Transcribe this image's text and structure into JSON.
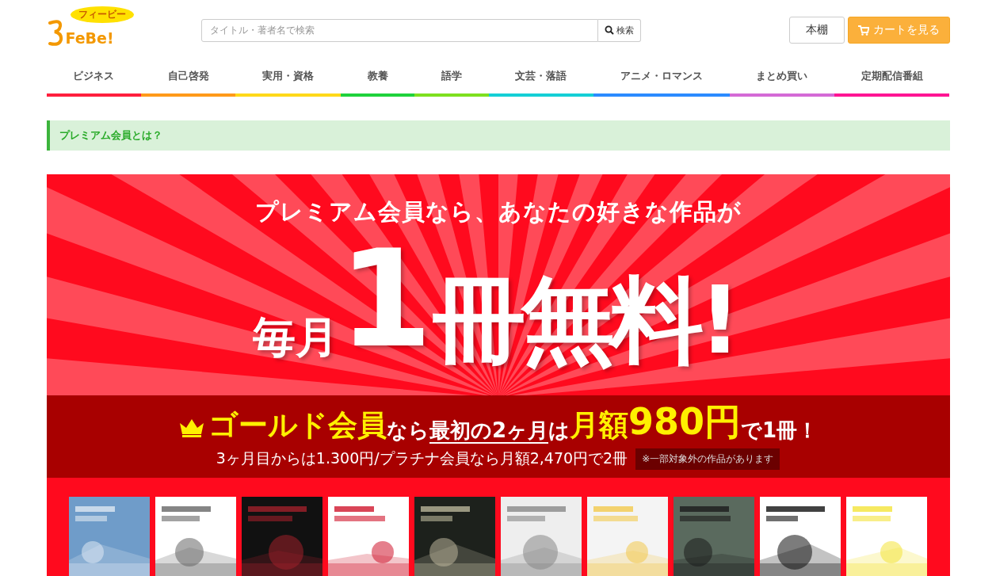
{
  "header": {
    "logo": {
      "name": "FeBe!",
      "badge": "フィービー"
    },
    "search": {
      "placeholder": "タイトル・著者名で検索",
      "button": "検索"
    },
    "buttons": [
      {
        "label": "本棚",
        "kind": "plain"
      },
      {
        "label": "カートを見る",
        "kind": "cart"
      }
    ]
  },
  "nav": [
    {
      "label": "ビジネス",
      "color": "#ff1f3d"
    },
    {
      "label": "自己啓発",
      "color": "#ff9a1a"
    },
    {
      "label": "実用・資格",
      "color": "#ffd91a"
    },
    {
      "label": "教養",
      "color": "#1fd23c"
    },
    {
      "label": "語学",
      "color": "#7ee01f"
    },
    {
      "label": "文芸・落語",
      "color": "#14cfd6"
    },
    {
      "label": "アニメ・ロマンス",
      "color": "#2b8bff"
    },
    {
      "label": "まとめ買い",
      "color": "#d46ad6"
    },
    {
      "label": "定期配信番組",
      "color": "#ff1493"
    }
  ],
  "notice": "プレミアム会員とは？",
  "banner": {
    "lead": "プレミアム会員なら、あなたの好きな作品が",
    "headline": [
      {
        "text": "毎月",
        "kind": "small"
      },
      {
        "text": "1",
        "kind": "huge"
      },
      {
        "text": "冊無料!",
        "kind": "large"
      }
    ],
    "offer": [
      {
        "text": "ゴールド会員",
        "kind": "accent"
      },
      {
        "text": "なら",
        "kind": "plain"
      },
      {
        "text": "最初の2ヶ月",
        "kind": "underline"
      },
      {
        "text": "は",
        "kind": "plain"
      },
      {
        "text": "月額",
        "kind": "accent"
      },
      {
        "text": "980円",
        "kind": "price"
      },
      {
        "text": "で1冊！",
        "kind": "plain"
      }
    ],
    "subline": "3ヶ月目からは1.300円/プラチナ会員なら月額2,470円で2冊",
    "note": "※一部対象外の作品があります"
  }
}
